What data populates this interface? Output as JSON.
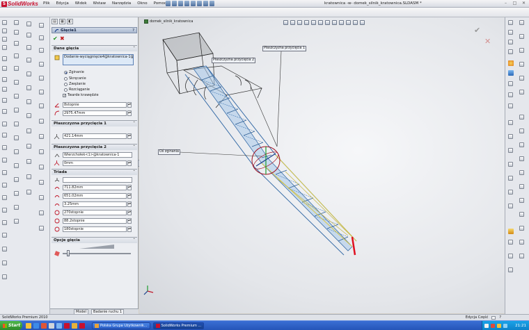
{
  "window": {
    "app_name": "SolidWorks",
    "doc_title": "kratownica -w- domek_silnik_kratownica.SLDASM *"
  },
  "menu": [
    "Plik",
    "Edycja",
    "Widok",
    "Wstaw",
    "Narzędzia",
    "Okno",
    "Pomoc"
  ],
  "property_manager": {
    "title": "Gięcie1",
    "help": "?",
    "groups": {
      "bend_data": {
        "label": "Dane gięcia",
        "body_field": "Dodanie-wyciągnięcie4@kratownica-1@domek",
        "options": [
          "Zginanie",
          "Skręcanie",
          "Zwężanie",
          "Rozciąganie"
        ],
        "selected_option": "Zginanie",
        "hard_edges_label": "Twarde krawędzie",
        "hard_edges_checked": true,
        "angle": "8stopnie",
        "radius": "2975.47mm"
      },
      "trim_plane_1": {
        "label": "Płaszczyzna przycięcia 1",
        "offset": "421.14mm"
      },
      "trim_plane_2": {
        "label": "Płaszczyzna przycięcia 2",
        "reference": "Wierzchołek<1>@kratownica-1",
        "offset": "0mm"
      },
      "triad": {
        "label": "Triada",
        "values": [
          "711.82mm",
          "651.02mm",
          "3.25mm",
          "270stopnie",
          "88.2stopnie",
          "180stopnie"
        ]
      },
      "bend_options": {
        "label": "Opcje gięcia"
      }
    }
  },
  "tree_tabs": [
    "Model",
    "Badanie ruchu 1"
  ],
  "viewport": {
    "tree_flyout_label": "domek_silnik_kratownica",
    "callouts": {
      "trim_plane_1": "Płaszczyzna przycięcia 1",
      "trim_plane_2": "Płaszczyzna przycięcia 2",
      "bend_axis": "Oś zginania"
    }
  },
  "status": {
    "left": "SolidWorks Premium 2010",
    "right": "Edycja Część"
  },
  "taskbar": {
    "start": "Start",
    "buttons": [
      "Polska Grupa Użytkownik...",
      "SolidWorks Premium ..."
    ],
    "clock": "21:21"
  },
  "colors": {
    "brand": "#c8102e",
    "selection_blue": "#1b3f8a",
    "truss_blue": "#6fa5d8",
    "bend_red": "#c0182a"
  }
}
